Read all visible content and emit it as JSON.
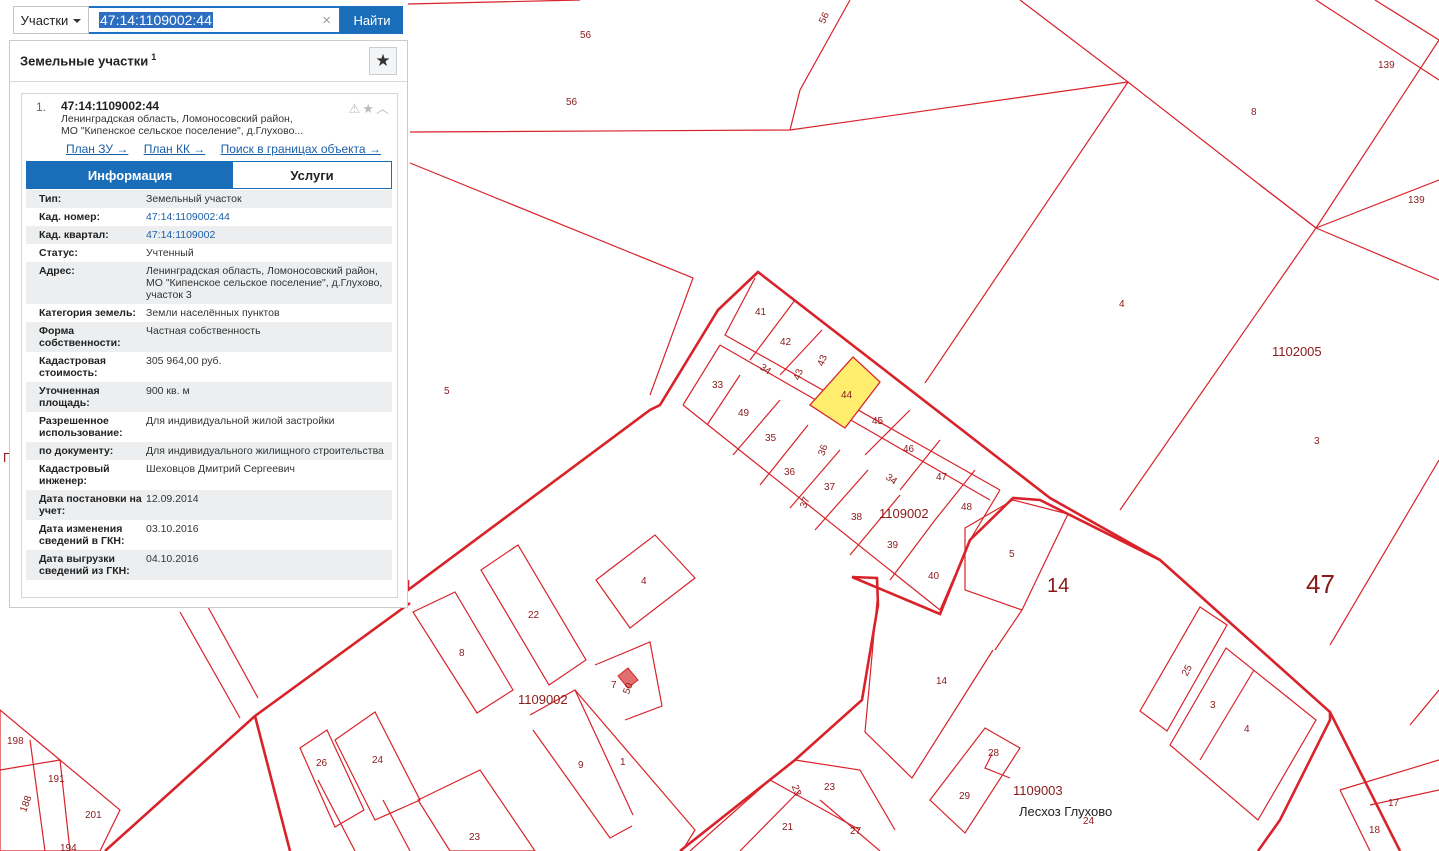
{
  "search": {
    "layer": "Участки",
    "query": "47:14:1109002:44",
    "clear_glyph": "×",
    "button": "Найти"
  },
  "panel": {
    "title": "Земельные участки",
    "count": "1",
    "favorite_icon": "star-icon",
    "card": {
      "index": "1.",
      "cad_number": "47:14:1109002:44",
      "address_line1": "Ленинградская область, Ломоносовский район,",
      "address_line2": "МО \"Кипенское сельское поселение\", д.Глухово...",
      "links": [
        "План ЗУ →",
        "План КК →",
        "Поиск в границах объекта →"
      ],
      "tabs": {
        "info": "Информация",
        "services": "Услуги"
      }
    },
    "attributes": [
      {
        "k": "Тип:",
        "v": "Земельный участок"
      },
      {
        "k": "Кад. номер:",
        "v": "47:14:1109002:44"
      },
      {
        "k": "Кад. квартал:",
        "v": "47:14:1109002"
      },
      {
        "k": "Статус:",
        "v": "Учтенный"
      },
      {
        "k": "Адрес:",
        "v": "Ленинградская область, Ломоносовский район, МО \"Кипенское сельское поселение\", д.Глухово, участок 3"
      },
      {
        "k": "Категория земель:",
        "v": "Земли населённых пунктов"
      },
      {
        "k": "Форма собственности:",
        "v": "Частная собственность"
      },
      {
        "k": "Кадастровая стоимость:",
        "v": "305 964,00 руб."
      },
      {
        "k": "Уточненная площадь:",
        "v": "900 кв. м"
      },
      {
        "k": "Разрешенное использование:",
        "v": "Для индивидуальной жилой застройки"
      },
      {
        "k": "по документу:",
        "v": "Для индивидуального жилищного строительства"
      },
      {
        "k": "Кадастровый инженер:",
        "v": "Шеховцов Дмитрий Сергеевич"
      },
      {
        "k": "Дата постановки на учет:",
        "v": "12.09.2014"
      },
      {
        "k": "Дата изменения сведений в ГКН:",
        "v": "03.10.2016"
      },
      {
        "k": "Дата выгрузки сведений из ГКН:",
        "v": "04.10.2016"
      }
    ]
  },
  "map": {
    "colors": {
      "boundary": "#d8232a",
      "highlight": "#ffee6e",
      "label": "#8a1a1a"
    },
    "labels": {
      "p56a": "56",
      "p56b": "56",
      "p56c": "56",
      "p8": "8",
      "p139a": "139",
      "p139b": "139",
      "p4": "4",
      "q1102005": "1102005",
      "p3": "3",
      "p5": "5",
      "p41": "41",
      "p42": "42",
      "p43": "43",
      "p43b": "43",
      "p44": "44",
      "p45": "45",
      "p46": "46",
      "p47": "47",
      "p48": "48",
      "p33": "33",
      "p49": "49",
      "p35": "35",
      "p36": "36",
      "p36b": "36",
      "p37": "37",
      "p37b": "37",
      "p38": "38",
      "p39": "39",
      "p40": "40",
      "p34a": "34",
      "p34b": "34",
      "q1109002a": "1109002",
      "p5b": "5",
      "big14": "14",
      "big47": "47",
      "p4b": "4",
      "p22": "22",
      "p8b": "8",
      "p7": "7",
      "p50": "50",
      "q1109002b": "1109002",
      "p9": "9",
      "p1": "1",
      "p14": "14",
      "p25": "25",
      "p3b": "3",
      "p4c": "4",
      "p28": "28",
      "p29": "29",
      "q1109003": "1109003",
      "leskhoz": "Лесхоз Глухово",
      "p24b": "24",
      "p198": "198",
      "p191": "191",
      "p188": "188",
      "p201": "201",
      "p194": "194",
      "p26": "26",
      "p24": "24",
      "p23": "23",
      "p23b": "23",
      "p23c": "23",
      "p21": "21",
      "p27": "27",
      "p17": "17",
      "p18": "18",
      "edgeP": "П"
    }
  }
}
